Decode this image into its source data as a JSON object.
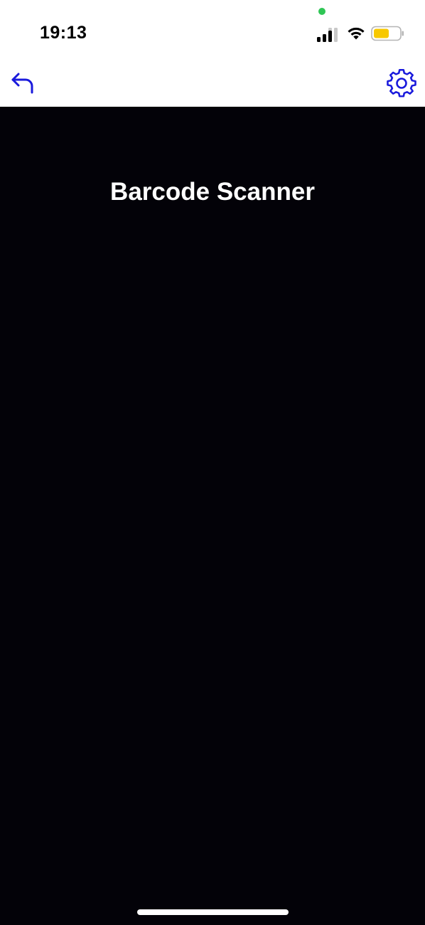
{
  "status_bar": {
    "time": "19:13",
    "signal_icon": "cellular-signal-icon",
    "wifi_icon": "wifi-icon",
    "battery_icon": "battery-icon",
    "battery_level": 0.6,
    "colors": {
      "privacy_dot": "#2fc655",
      "battery_fill": "#f7c800"
    }
  },
  "nav": {
    "back_icon": "back-arrow-icon",
    "settings_icon": "gear-icon",
    "icon_color": "#1a1adc"
  },
  "scanner": {
    "title": "Barcode Scanner",
    "background_color": "#030208"
  }
}
